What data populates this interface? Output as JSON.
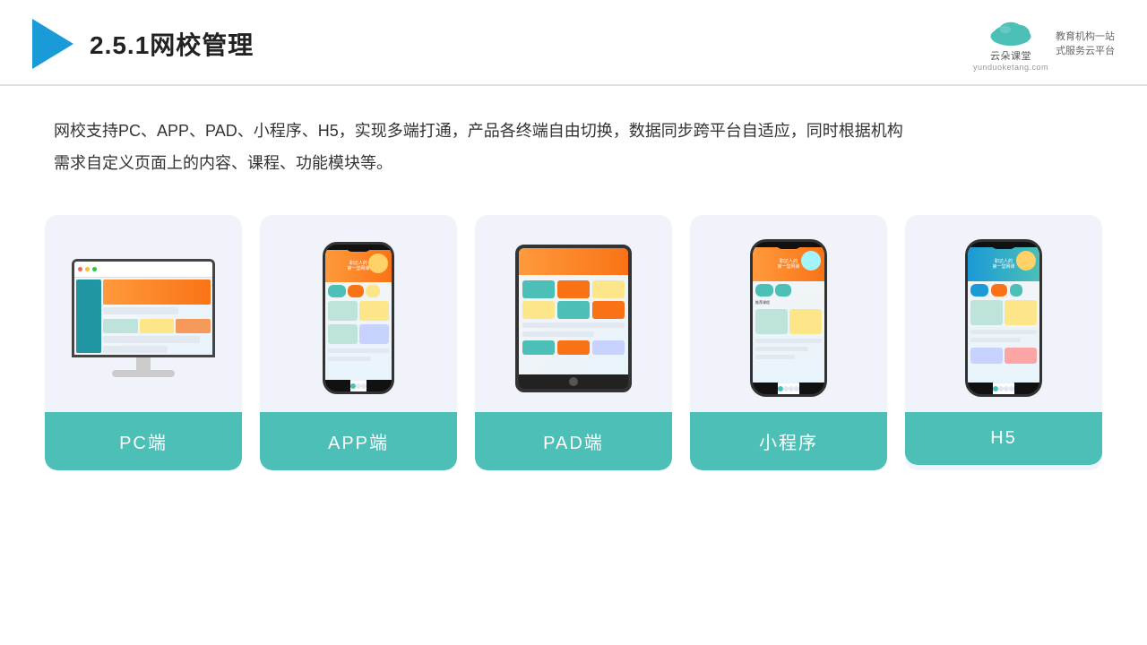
{
  "header": {
    "title": "2.5.1网校管理",
    "brand_name": "云朵课堂",
    "brand_url": "yunduoketang.com",
    "brand_tagline": "教育机构一站\n式服务云平台"
  },
  "description": "网校支持PC、APP、PAD、小程序、H5，实现多端打通，产品各终端自由切换，数据同步跨平台自适应，同时根据机构\n需求自定义页面上的内容、课程、功能模块等。",
  "cards": [
    {
      "id": "pc",
      "label": "PC端"
    },
    {
      "id": "app",
      "label": "APP端"
    },
    {
      "id": "pad",
      "label": "PAD端"
    },
    {
      "id": "miniprogram",
      "label": "小程序"
    },
    {
      "id": "h5",
      "label": "H5"
    }
  ],
  "colors": {
    "accent": "#4cbfb6",
    "header_border": "#e0e0e0",
    "triangle": "#1a9ad7",
    "card_bg": "#f0f4fa"
  }
}
